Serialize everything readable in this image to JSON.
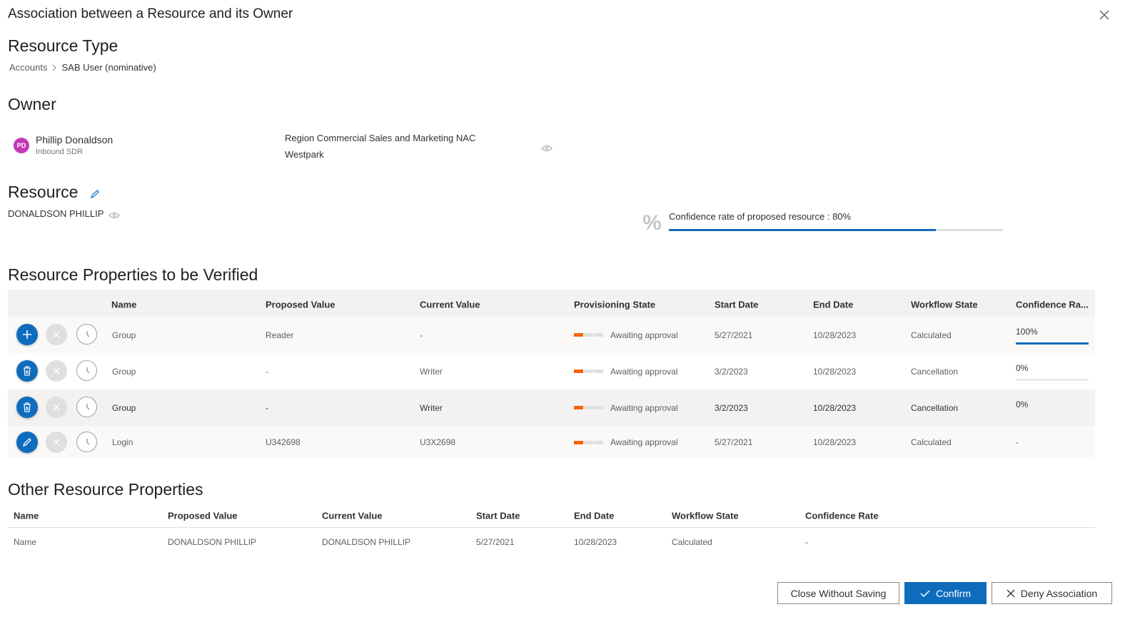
{
  "dialog": {
    "title": "Association between a Resource and its Owner"
  },
  "resource_type": {
    "heading": "Resource Type",
    "breadcrumb": [
      "Accounts",
      "SAB User (nominative)"
    ]
  },
  "owner": {
    "heading": "Owner",
    "initials": "PD",
    "name": "Phillip Donaldson",
    "role": "Inbound SDR",
    "org_line1": "Region Commercial Sales and Marketing NAC",
    "org_line2": "Westpark"
  },
  "resource": {
    "heading": "Resource",
    "name": "DONALDSON PHILLIP",
    "confidence_label": "Confidence rate of proposed resource : 80%",
    "confidence_value": 0.8,
    "percent_symbol": "%"
  },
  "verified": {
    "heading": "Resource Properties to be Verified",
    "columns": [
      "Name",
      "Proposed Value",
      "Current Value",
      "Provisioning State",
      "Start Date",
      "End Date",
      "Workflow State",
      "Confidence Ra..."
    ],
    "rows": [
      {
        "action": "add",
        "name": "Group",
        "proposed": "Reader",
        "current": "-",
        "prov": "Awaiting approval",
        "start": "5/27/2021",
        "end": "10/28/2023",
        "workflow": "Calculated",
        "confidence": "100%",
        "confidence_value": 1.0
      },
      {
        "action": "delete",
        "name": "Group",
        "proposed": "-",
        "current": "Writer",
        "prov": "Awaiting approval",
        "start": "3/2/2023",
        "end": "10/28/2023",
        "workflow": "Cancellation",
        "confidence": "0%",
        "confidence_value": 0
      },
      {
        "action": "delete",
        "name": "Group",
        "proposed": "-",
        "current": "Writer",
        "prov": "Awaiting approval",
        "start": "3/2/2023",
        "end": "10/28/2023",
        "workflow": "Cancellation",
        "confidence": "0%",
        "confidence_value": 0
      },
      {
        "action": "edit",
        "name": "Login",
        "proposed": "U342698",
        "current": "U3X2698",
        "prov": "Awaiting approval",
        "start": "5/27/2021",
        "end": "10/28/2023",
        "workflow": "Calculated",
        "confidence": "-",
        "confidence_value": null
      }
    ]
  },
  "other": {
    "heading": "Other Resource Properties",
    "columns": [
      "Name",
      "Proposed Value",
      "Current Value",
      "Start Date",
      "End Date",
      "Workflow State",
      "Confidence Rate"
    ],
    "rows": [
      {
        "name": "Name",
        "proposed": "DONALDSON PHILLIP",
        "current": "DONALDSON PHILLIP",
        "start": "5/27/2021",
        "end": "10/28/2023",
        "workflow": "Calculated",
        "confidence": "-"
      }
    ]
  },
  "footer": {
    "close_label": "Close Without Saving",
    "confirm_label": "Confirm",
    "deny_label": "Deny Association"
  },
  "colors": {
    "accent": "#0f6cbd",
    "avatar": "#c239b3",
    "provisioning": "#f7630c"
  }
}
